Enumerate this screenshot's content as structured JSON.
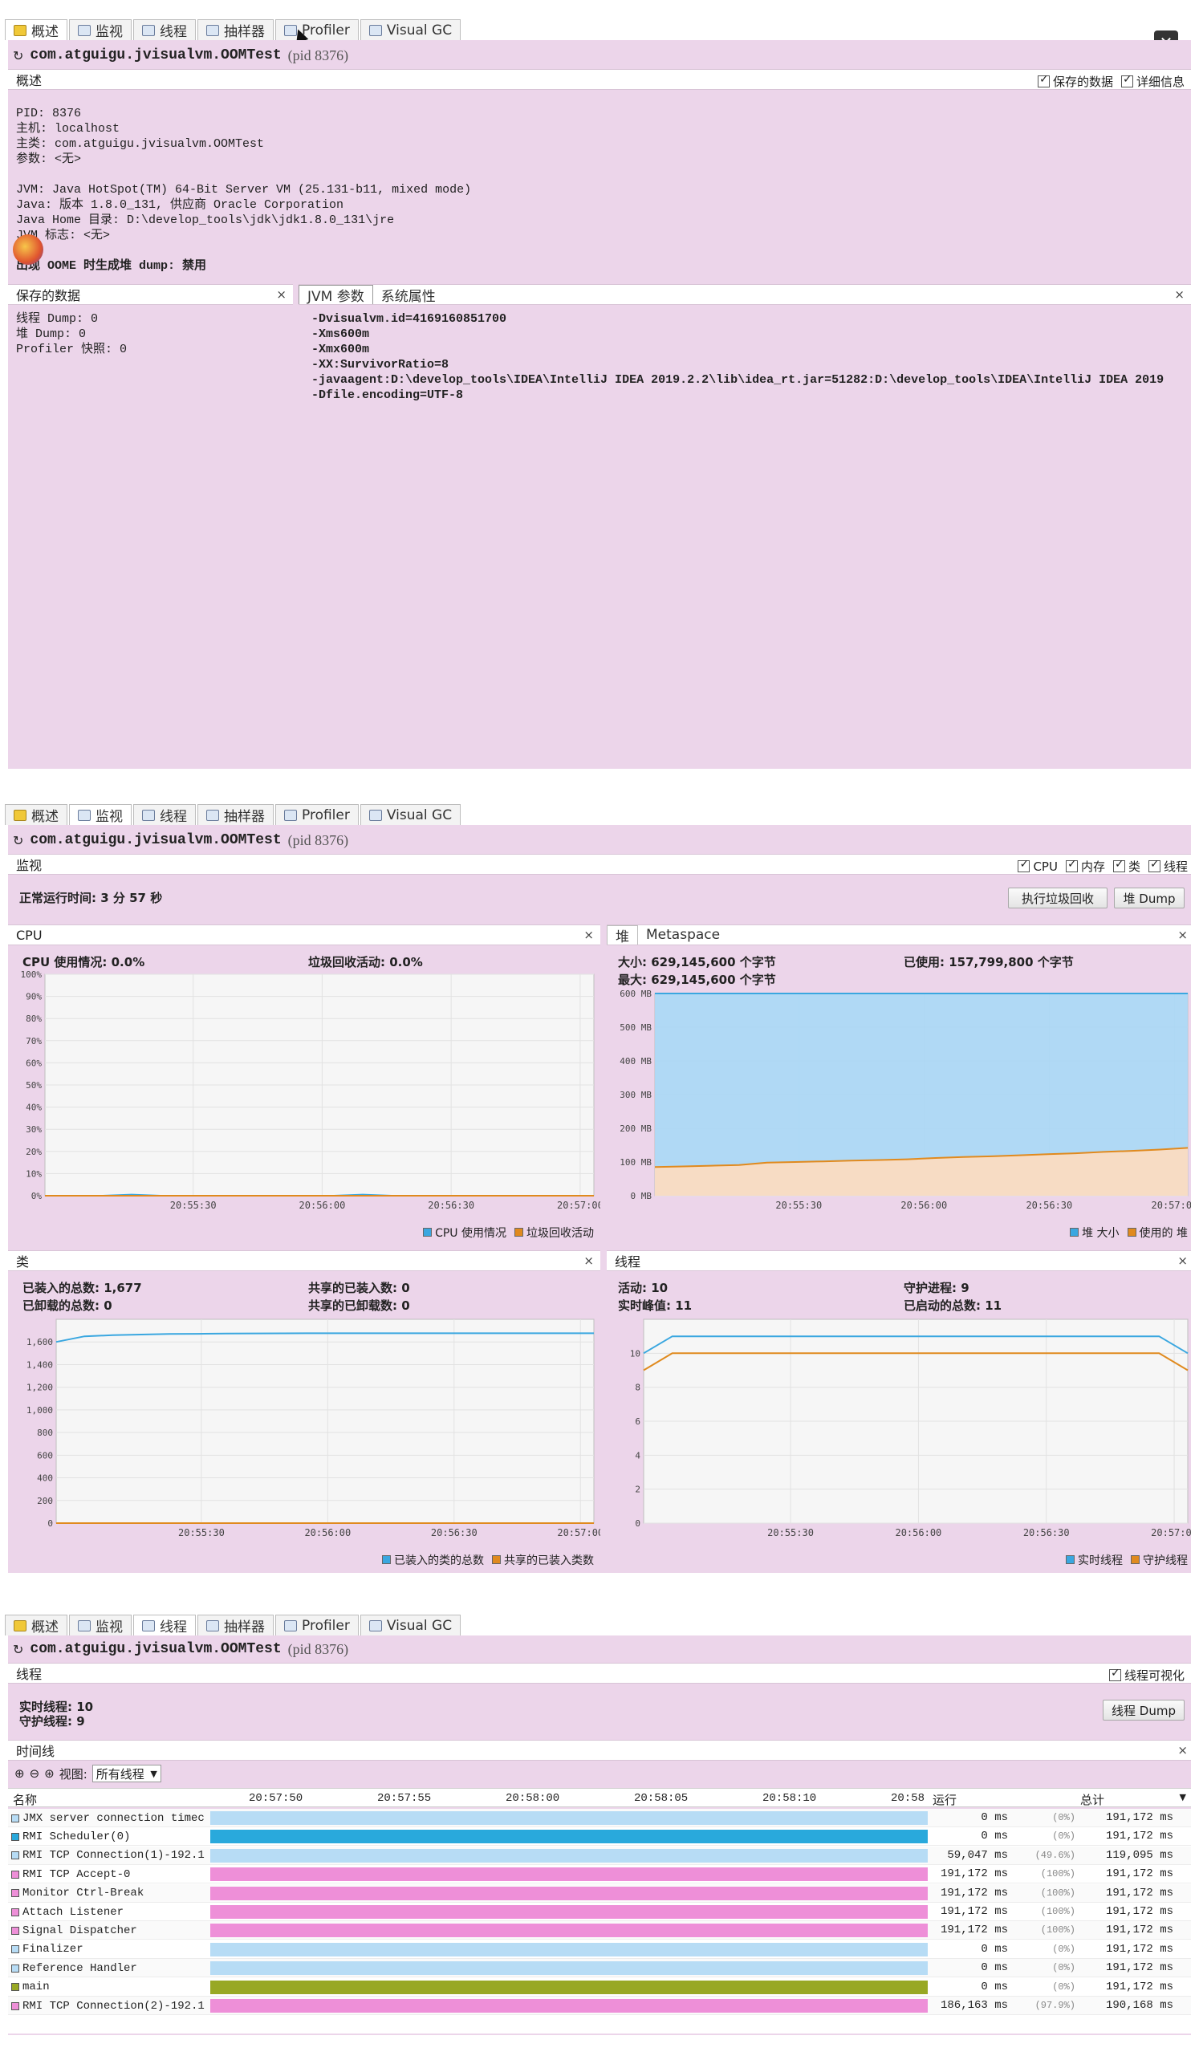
{
  "tabs": [
    {
      "label": "概述",
      "icon": "overview-icon"
    },
    {
      "label": "监视",
      "icon": "monitor-icon"
    },
    {
      "label": "线程",
      "icon": "threads-icon"
    },
    {
      "label": "抽样器",
      "icon": "sampler-icon"
    },
    {
      "label": "Profiler",
      "icon": "profiler-icon"
    },
    {
      "label": "Visual GC",
      "icon": "visualgc-icon"
    }
  ],
  "process": {
    "name": "com.atguigu.jvisualvm.OOMTest",
    "pid": "(pid 8376)"
  },
  "overview": {
    "title": "概述",
    "opt_saved": "保存的数据",
    "opt_detail": "详细信息",
    "info_lines": [
      "PID: 8376",
      "主机: localhost",
      "主类: com.atguigu.jvisualvm.OOMTest",
      "参数: <无>",
      "",
      "JVM: Java HotSpot(TM) 64-Bit Server VM (25.131-b11, mixed mode)",
      "Java: 版本 1.8.0_131, 供应商 Oracle Corporation",
      "Java Home 目录: D:\\develop_tools\\jdk\\jdk1.8.0_131\\jre",
      "JVM 标志: <无>",
      "",
      "出现 OOME 时生成堆 dump: 禁用"
    ],
    "saved_tab": "保存的数据",
    "saved_lines": [
      "线程 Dump: 0",
      "堆 Dump: 0",
      "Profiler 快照: 0"
    ],
    "jvm_tab": "JVM 参数",
    "sys_tab": "系统属性",
    "jvm_args": [
      "-Dvisualvm.id=4169160851700",
      "-Xms600m",
      "-Xmx600m",
      "-XX:SurvivorRatio=8",
      "-javaagent:D:\\develop_tools\\IDEA\\IntelliJ  IDEA  2019.2.2\\lib\\idea_rt.jar=51282:D:\\develop_tools\\IDEA\\IntelliJ  IDEA  2019",
      "-Dfile.encoding=UTF-8"
    ]
  },
  "monitor": {
    "title": "监视",
    "checks": [
      "CPU",
      "内存",
      "类",
      "线程"
    ],
    "uptime": "正常运行时间: 3 分 57 秒",
    "gc_button": "执行垃圾回收",
    "heap_button": "堆 Dump",
    "cpu": {
      "tab": "CPU",
      "usage": "CPU 使用情况: 0.0%",
      "gc": "垃圾回收活动: 0.0%",
      "legend": [
        "CPU 使用情况",
        "垃圾回收活动"
      ]
    },
    "heap": {
      "tab1": "堆",
      "tab2": "Metaspace",
      "size": "大小: 629,145,600 个字节",
      "max": "最大: 629,145,600 个字节",
      "used": "已使用: 157,799,800 个字节",
      "legend": [
        "堆 大小",
        "使用的 堆"
      ]
    },
    "classes": {
      "tab": "类",
      "loaded": "已装入的总数: 1,677",
      "unloaded": "已卸载的总数: 0",
      "shared_loaded": "共享的已装入数: 0",
      "shared_unloaded": "共享的已卸载数: 0",
      "legend": [
        "已装入的类的总数",
        "共享的已装入类数"
      ]
    },
    "threads": {
      "tab": "线程",
      "live": "活动: 10",
      "peak": "实时峰值: 11",
      "daemon": "守护进程: 9",
      "started": "已启动的总数: 11",
      "legend": [
        "实时线程",
        "守护线程"
      ]
    }
  },
  "threadview": {
    "title": "线程",
    "visual_check": "线程可视化",
    "live": "实时线程: 10",
    "daemon": "守护线程: 9",
    "dump_button": "线程 Dump",
    "timeline": "时间线",
    "view_label": "视图:",
    "view_value": "所有线程",
    "col_name": "名称",
    "col_run": "运行",
    "col_total": "总计",
    "times": [
      "20:57:50",
      "20:57:55",
      "20:58:00",
      "20:58:05",
      "20:58:10",
      "20:58"
    ],
    "rows": [
      {
        "name": "JMX server connection timec",
        "state": "#b7dcf5",
        "run": "0 ms",
        "pct": "(0%)",
        "total": "191,172 ms"
      },
      {
        "name": "RMI Scheduler(0)",
        "state": "#29a9dc",
        "run": "0 ms",
        "pct": "(0%)",
        "total": "191,172 ms"
      },
      {
        "name": "RMI TCP Connection(1)-192.1",
        "state": "#b7dcf5",
        "run": "59,047 ms",
        "pct": "(49.6%)",
        "total": "119,095 ms"
      },
      {
        "name": "RMI TCP Accept-0",
        "state": "#ee8fd8",
        "run": "191,172 ms",
        "pct": "(100%)",
        "total": "191,172 ms"
      },
      {
        "name": "Monitor Ctrl-Break",
        "state": "#ee8fd8",
        "run": "191,172 ms",
        "pct": "(100%)",
        "total": "191,172 ms"
      },
      {
        "name": "Attach Listener",
        "state": "#ee8fd8",
        "run": "191,172 ms",
        "pct": "(100%)",
        "total": "191,172 ms"
      },
      {
        "name": "Signal Dispatcher",
        "state": "#ee8fd8",
        "run": "191,172 ms",
        "pct": "(100%)",
        "total": "191,172 ms"
      },
      {
        "name": "Finalizer",
        "state": "#b7dcf5",
        "run": "0 ms",
        "pct": "(0%)",
        "total": "191,172 ms"
      },
      {
        "name": "Reference Handler",
        "state": "#b7dcf5",
        "run": "0 ms",
        "pct": "(0%)",
        "total": "191,172 ms"
      },
      {
        "name": "main",
        "state": "#98a824",
        "run": "0 ms",
        "pct": "(0%)",
        "total": "191,172 ms"
      },
      {
        "name": "RMI TCP Connection(2)-192.1",
        "state": "#ee8fd8",
        "run": "186,163 ms",
        "pct": "(97.9%)",
        "total": "190,168 ms"
      }
    ]
  },
  "chart_data": [
    {
      "type": "line",
      "title": "CPU",
      "x_ticks": [
        "20:55:30",
        "20:56:00",
        "20:56:30",
        "20:57:00"
      ],
      "y_ticks": [
        "0%",
        "10%",
        "20%",
        "30%",
        "40%",
        "50%",
        "60%",
        "70%",
        "80%",
        "90%",
        "100%"
      ],
      "ylim": [
        0,
        100
      ],
      "series": [
        {
          "name": "CPU 使用情况",
          "color": "#3aa7e0",
          "values": [
            0,
            0,
            0,
            0.5,
            0,
            0,
            0,
            0,
            0,
            0,
            0,
            0.5,
            0,
            0,
            0,
            0,
            0,
            0,
            0,
            0
          ]
        },
        {
          "name": "垃圾回收活动",
          "color": "#e08a1e",
          "values": [
            0,
            0,
            0,
            0,
            0,
            0,
            0,
            0,
            0,
            0,
            0,
            0,
            0,
            0,
            0,
            0,
            0,
            0,
            0,
            0
          ]
        }
      ]
    },
    {
      "type": "area",
      "title": "堆",
      "x_ticks": [
        "20:55:30",
        "20:56:00",
        "20:56:30",
        "20:57:00"
      ],
      "y_ticks": [
        "0 MB",
        "100 MB",
        "200 MB",
        "300 MB",
        "400 MB",
        "500 MB",
        "600 MB"
      ],
      "ylim": [
        0,
        600
      ],
      "series": [
        {
          "name": "堆 大小",
          "color": "#3aa7e0",
          "values": [
            600,
            600,
            600,
            600,
            600,
            600,
            600,
            600,
            600,
            600,
            600,
            600,
            600,
            600,
            600,
            600,
            600,
            600,
            600,
            600
          ]
        },
        {
          "name": "使用的 堆",
          "color": "#e08a1e",
          "values": [
            85,
            87,
            89,
            91,
            98,
            100,
            102,
            104,
            106,
            108,
            112,
            115,
            117,
            120,
            123,
            126,
            130,
            133,
            137,
            142
          ]
        }
      ]
    },
    {
      "type": "line",
      "title": "类",
      "x_ticks": [
        "20:55:30",
        "20:56:00",
        "20:56:30",
        "20:57:00"
      ],
      "y_ticks": [
        "0",
        "200",
        "400",
        "600",
        "800",
        "1,000",
        "1,200",
        "1,400",
        "1,600"
      ],
      "ylim": [
        0,
        1800
      ],
      "series": [
        {
          "name": "已装入的类的总数",
          "color": "#3aa7e0",
          "values": [
            1600,
            1650,
            1660,
            1665,
            1670,
            1672,
            1674,
            1675,
            1676,
            1677,
            1677,
            1677,
            1677,
            1677,
            1677,
            1677,
            1677,
            1677,
            1677,
            1677
          ]
        },
        {
          "name": "共享的已装入类数",
          "color": "#e08a1e",
          "values": [
            0,
            0,
            0,
            0,
            0,
            0,
            0,
            0,
            0,
            0,
            0,
            0,
            0,
            0,
            0,
            0,
            0,
            0,
            0,
            0
          ]
        }
      ]
    },
    {
      "type": "line",
      "title": "线程",
      "x_ticks": [
        "20:55:30",
        "20:56:00",
        "20:56:30",
        "20:57:00"
      ],
      "y_ticks": [
        "0",
        "2",
        "4",
        "6",
        "8",
        "10"
      ],
      "ylim": [
        0,
        12
      ],
      "series": [
        {
          "name": "实时线程",
          "color": "#3aa7e0",
          "values": [
            10,
            11,
            11,
            11,
            11,
            11,
            11,
            11,
            11,
            11,
            11,
            11,
            11,
            11,
            11,
            11,
            11,
            11,
            11,
            10
          ]
        },
        {
          "name": "守护线程",
          "color": "#e08a1e",
          "values": [
            9,
            10,
            10,
            10,
            10,
            10,
            10,
            10,
            10,
            10,
            10,
            10,
            10,
            10,
            10,
            10,
            10,
            10,
            10,
            9
          ]
        }
      ]
    }
  ]
}
